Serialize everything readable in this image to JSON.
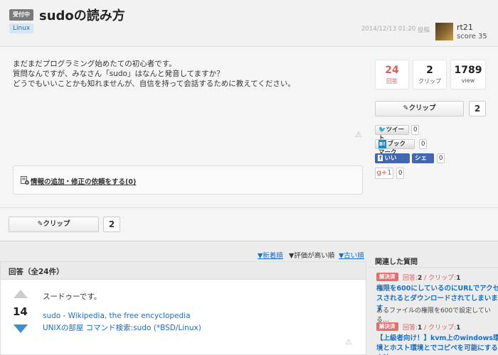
{
  "question": {
    "status": "受付中",
    "title": "sudoの読み方",
    "tag": "Linux",
    "date": "2014/12/13 01:20",
    "posted_label": "投稿",
    "user": {
      "name": "rt21",
      "score": "score 35"
    },
    "body": [
      "まだまだプログラミング始めたての初心者です。",
      "質問なんですが、みなさん「sudo」はなんと発音してますか？",
      "どうでもいいことかも知れませんが、自信を持って会話するために教えてください。"
    ],
    "edit_request": "情報の追加・修正の依頼をする(0)"
  },
  "stats": {
    "answers": {
      "value": "24",
      "label": "回答"
    },
    "clips": {
      "value": "2",
      "label": "クリップ"
    },
    "views": {
      "value": "1789",
      "label": "view"
    }
  },
  "clip": {
    "label": "クリップ",
    "count": "2"
  },
  "social": {
    "tweet": {
      "label": "ツイート",
      "count": "0"
    },
    "hatena": {
      "badge": "B!",
      "label": "ブックマーク",
      "count": "0"
    },
    "fb_like": {
      "label": "いいね！",
      "count": "0"
    },
    "fb_share": {
      "label": "シェア",
      "count": "0"
    },
    "gplus": {
      "label": "g+1",
      "count": "0"
    }
  },
  "sort": {
    "newest": "▼新着順",
    "rating": "▼評価が高い順",
    "oldest": "▼古い順"
  },
  "answers": {
    "header": "回答（全24件）",
    "items": [
      {
        "votes": "14",
        "text": "スードゥーです。",
        "links": [
          "sudo - Wikipedia, the free encyclopedia",
          "UNIXの部屋 コマンド検索:sudo (*BSD/Linux)"
        ]
      }
    ]
  },
  "related": {
    "title": "関連した質問",
    "items": [
      {
        "status": "解決済",
        "answers_label": "回答:",
        "answers": "2",
        "clips_label": " / クリップ:",
        "clips": "1",
        "title": "権限を600にしているのにURLでアクセスされるとダウンロードされてしまいます",
        "snippet": "あるファイルの権限を600で設定している…"
      },
      {
        "status": "解決済",
        "answers_label": "回答:",
        "answers": "1",
        "clips_label": " / クリップ:",
        "clips": "1",
        "title": "【上級者向け！】kvm上のwindows環境とホスト環境とでコピペを可能にする方法"
      }
    ]
  }
}
